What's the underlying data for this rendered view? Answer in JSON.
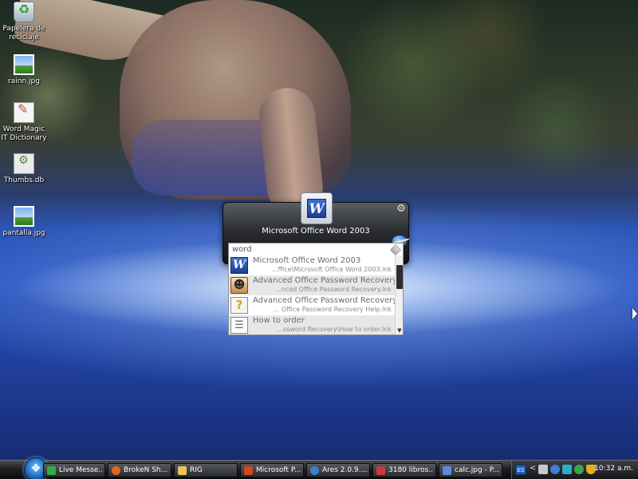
{
  "desktop": {
    "icons": [
      {
        "label": "Papelera de reciclaje",
        "icon": "recycle-bin-icon"
      },
      {
        "label": "rainn.jpg",
        "icon": "image-file-icon"
      },
      {
        "label": "Word Magic IT Dictionary",
        "icon": "dictionary-shortcut-icon"
      },
      {
        "label": "Thumbs.db",
        "icon": "database-file-icon"
      },
      {
        "label": "pantalla.jpg",
        "icon": "image-file-icon"
      }
    ]
  },
  "launcher": {
    "app_title": "Microsoft Office Word 2003",
    "app_icon": "word-icon",
    "search_value": "word",
    "results": [
      {
        "name": "Microsoft Office Word 2003",
        "path": "...ffice\\Microsoft Office Word 2003.lnk",
        "icon": "word-icon"
      },
      {
        "name": "Advanced Office Password Recovery",
        "path": "...nced Office Password Recovery.lnk",
        "icon": "password-recovery-icon"
      },
      {
        "name": "Advanced Office Password Recovery",
        "path": "... Office Password Recovery Help.lnk",
        "icon": "help-file-icon"
      },
      {
        "name": "How to order",
        "path": "...ssword Recovery\\How to order.lnk",
        "icon": "document-icon"
      }
    ]
  },
  "taskbar": {
    "buttons": [
      {
        "label": "Live Messe...",
        "icon_color": "#3aa84a"
      },
      {
        "label": "BrokeN Sh...",
        "icon_color": "#e06a1c"
      },
      {
        "label": "RIG",
        "icon_color": "#e8c45a"
      },
      {
        "label": "Microsoft P...",
        "icon_color": "#d04a1c"
      },
      {
        "label": "Ares 2.0.9....",
        "icon_color": "#3c7fd0"
      },
      {
        "label": "3180 libros...",
        "icon_color": "#c83c3c"
      },
      {
        "label": "calc.jpg - P...",
        "icon_color": "#5a8ad8"
      }
    ],
    "tray": {
      "language": "ES",
      "chevron": "<",
      "clock": "10:32 a.m."
    }
  },
  "colors": {
    "taskbar": "#1e1f22",
    "launcher_bg": "#2b2d31",
    "result_alt_row": "#e7e7e7"
  }
}
